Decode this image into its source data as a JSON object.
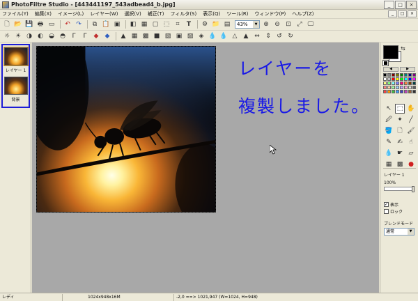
{
  "window": {
    "title": "PhotoFiltre Studio - [443441197_543adbead4_b.jpg]",
    "controls": [
      "_",
      "□",
      "×"
    ]
  },
  "menu": {
    "items": [
      "ファイル(Y)",
      "編集(X)",
      "イメージ(L)",
      "レイヤー(W)",
      "選択(V)",
      "補正(T)",
      "フィルタ(S)",
      "表示(Q)",
      "ツール(R)",
      "ウィンドウ(P)",
      "ヘルプ(Z)"
    ],
    "mdi_controls": [
      "_",
      "□",
      "×"
    ]
  },
  "toolbar": {
    "zoom_value": "43%"
  },
  "layers": {
    "items": [
      {
        "label": "レイヤー 1",
        "selected": true
      },
      {
        "label": "背景",
        "selected": false
      }
    ]
  },
  "canvas": {
    "overlay_line1": "レイヤーを",
    "overlay_line2": "複製しました。",
    "text_color": "#1a1ae6"
  },
  "tools": {
    "foreground_color": "#000000",
    "background_color": "#ffffff",
    "palette": [
      "#000000",
      "#808080",
      "#800000",
      "#808000",
      "#008000",
      "#008080",
      "#000080",
      "#800080",
      "#ffffff",
      "#c0c0c0",
      "#ff0000",
      "#ffff00",
      "#00ff00",
      "#00ffff",
      "#0000ff",
      "#ff00ff",
      "#ffff80",
      "#80ff80",
      "#80ffff",
      "#8080ff",
      "#ff0080",
      "#ff8040",
      "#804000",
      "#004040",
      "#ff8080",
      "#ffd0a0",
      "#a0ffa0",
      "#a0d0ff",
      "#c0a0ff",
      "#ffa0d0",
      "#e0e0e0",
      "#606060",
      "#ff4040",
      "#ff9900",
      "#40c040",
      "#40a0ff",
      "#4040c0",
      "#c040c0",
      "#a06030",
      "#303030"
    ],
    "layer_name": "レイヤー 1",
    "opacity": "100%",
    "opacity_fraction": 1.0,
    "show_label": "表示",
    "show_checked": true,
    "lock_label": "ロック",
    "lock_checked": false,
    "blend_label": "ブレンドモード",
    "blend_value": "通常"
  },
  "status": {
    "ready": "レディ",
    "size": "1024x948x16M",
    "coords": "-2,0 ==> 1021,947 (W=1024, H=948)"
  }
}
